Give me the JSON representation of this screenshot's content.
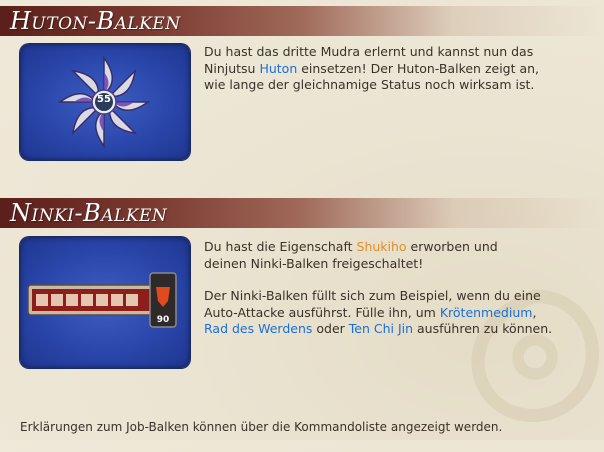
{
  "huton": {
    "title": "Huton-Balken",
    "line1": "Du hast das dritte Mudra erlernt und kannst nun das",
    "line2_pre": "Ninjutsu ",
    "line2_link": "Huton",
    "line2_post": " einsetzen! Der Huton-Balken zeigt an,",
    "line3": "wie lange der gleichnamige Status noch wirksam ist.",
    "gauge_value": "55"
  },
  "ninki": {
    "title": "Ninki-Balken",
    "p1_line1_pre": "Du hast die Eigenschaft ",
    "p1_line1_link": "Shukiho",
    "p1_line1_post": " erworben und",
    "p1_line2": "deinen Ninki-Balken freigeschaltet!",
    "p2_line1": "Der Ninki-Balken füllt sich zum Beispiel, wenn du eine",
    "p2_line2_pre": "Auto-Attacke ausführst. Fülle ihn, um ",
    "p2_line2_link": "Krötenmedium",
    "p2_line2_post": ",",
    "p2_line3_link1": "Rad des Werdens",
    "p2_line3_mid": " oder ",
    "p2_line3_link2": "Ten Chi Jin",
    "p2_line3_post": " ausführen zu können.",
    "gauge_value": "90"
  },
  "footer": "Erklärungen zum Job-Balken können über die Kommandoliste angezeigt werden.",
  "colors": {
    "header_dark": "#5a1f1a",
    "link_blue": "#1b6fd6",
    "link_orange": "#e0902a",
    "panel_blue": "#2a46aa"
  }
}
